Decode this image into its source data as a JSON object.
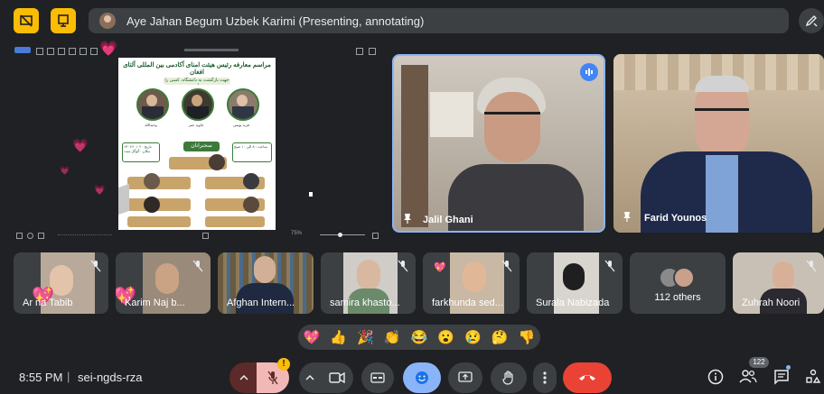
{
  "topbar": {
    "presenter_label": "Aye Jahan Begum Uzbek Karimi (Presenting, annotating)"
  },
  "slide": {
    "title_line1": "مراسم معارفه رئیس هیئت امنای آکادمی بین المللی آلتای افغان",
    "title_line2": "جهت بازگشت به دانشگاه، کسی را بیابید",
    "section_label": "سخنرانان",
    "date_label": "تاریخ : ۱۴۰۲/۱۰/۰۲",
    "place_label": "مکان : گوگل میت",
    "time_label": "ساعت : ۸ الی ۱۰ صبح",
    "speakers": [
      "وحیدالله",
      "جاوید عمر",
      "فرید یونس"
    ]
  },
  "slide_zoom": "75%",
  "tiles": {
    "jalil": {
      "name": "Jalil Ghani"
    },
    "farid": {
      "name": "Farid Younos"
    }
  },
  "participants": [
    {
      "name": "Ariana Tabib",
      "display": "Ar  na Tabib"
    },
    {
      "name": "Karim Najib",
      "display": "Karim Naj  b..."
    },
    {
      "name": "Afghan Intern...",
      "display": "Afghan Intern..."
    },
    {
      "name": "samira khasto...",
      "display": "samira khasto..."
    },
    {
      "name": "farkhunda sed...",
      "display": "farkhunda sed..."
    },
    {
      "name": "Surala Nabizada",
      "display": "Surala Nabizada"
    },
    {
      "name": "112 others",
      "display": "112 others"
    },
    {
      "name": "Zuhrah Noori",
      "display": "Zuhrah Noori"
    }
  ],
  "reactions": [
    "💖",
    "👍",
    "🎉",
    "👏",
    "😂",
    "😮",
    "😢",
    "🤔",
    "👎"
  ],
  "bottom": {
    "time": "8:55 PM",
    "separator": "|",
    "meeting_code": "sei-ngds-rza",
    "people_count": "122",
    "warning_badge": "!"
  }
}
